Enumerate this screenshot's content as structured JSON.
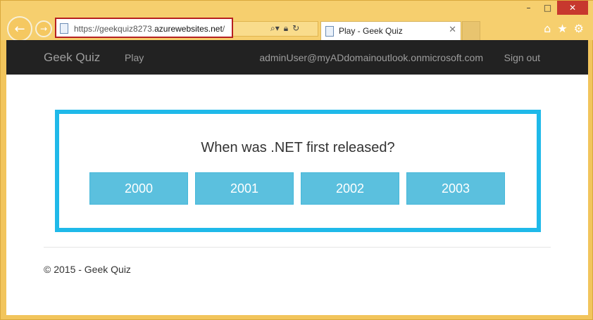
{
  "browser": {
    "url_prefix": "https://geekquiz8273.",
    "url_domain": "azurewebsites.net",
    "url_suffix": "/",
    "tab_title": "Play - Geek Quiz",
    "window_controls": {
      "minimize": "–",
      "maximize": "□",
      "close": "✕"
    },
    "icons": [
      "home-icon",
      "favorites-star-icon",
      "settings-gear-icon"
    ]
  },
  "navbar": {
    "brand": "Geek Quiz",
    "play": "Play",
    "user": "adminUser@myADdomainoutlook.onmicrosoft.com",
    "signout": "Sign out"
  },
  "quiz": {
    "question": "When was .NET first released?",
    "options": [
      "2000",
      "2001",
      "2002",
      "2003"
    ],
    "accent_color": "#1fb9e9",
    "button_color": "#5bc0de"
  },
  "footer": {
    "text": "© 2015 - Geek Quiz"
  }
}
